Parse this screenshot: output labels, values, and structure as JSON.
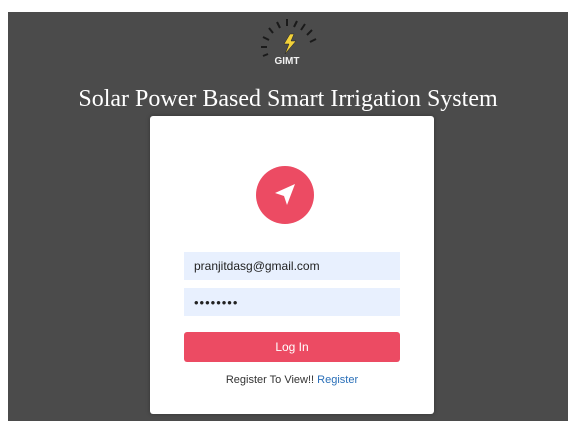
{
  "header": {
    "logo_text": "GIMT",
    "title": "Solar Power Based Smart Irrigation System"
  },
  "login": {
    "email_value": "pranjitdasg@gmail.com",
    "password_value": "••••••••",
    "login_label": "Log In",
    "register_prompt": "Register To View!!",
    "register_link": "Register"
  },
  "colors": {
    "accent": "#ec4b63",
    "backdrop": "#4b4b4b",
    "field_bg": "#e8f0fe",
    "link": "#2a6fb8"
  },
  "icons": {
    "logo": "gimt-logo",
    "app": "navigation-arrow-icon"
  }
}
